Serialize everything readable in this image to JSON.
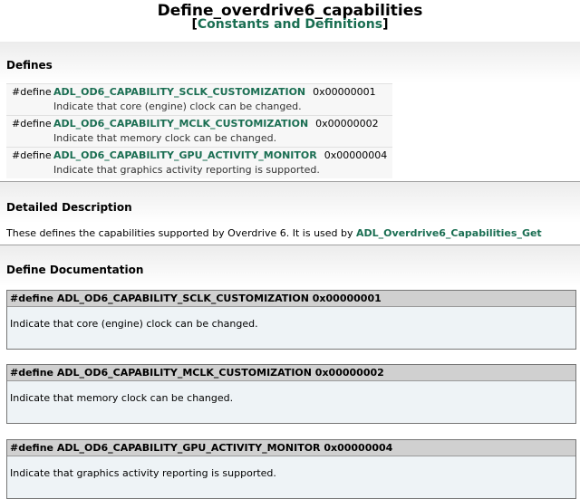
{
  "header": {
    "title": "Define_overdrive6_capabilities",
    "bracket_open": "[",
    "group_link": "Constants and Definitions",
    "bracket_close": "]"
  },
  "defines_section": {
    "heading": "Defines",
    "items": [
      {
        "keyword": "#define",
        "name": "ADL_OD6_CAPABILITY_SCLK_CUSTOMIZATION",
        "value": "0x00000001",
        "brief": "Indicate that core (engine) clock can be changed."
      },
      {
        "keyword": "#define",
        "name": "ADL_OD6_CAPABILITY_MCLK_CUSTOMIZATION",
        "value": "0x00000002",
        "brief": "Indicate that memory clock can be changed."
      },
      {
        "keyword": "#define",
        "name": "ADL_OD6_CAPABILITY_GPU_ACTIVITY_MONITOR",
        "value": "0x00000004",
        "brief": "Indicate that graphics activity reporting is supported."
      }
    ]
  },
  "detailed": {
    "heading": "Detailed Description",
    "text": "These defines the capabilities supported by Overdrive 6. It is used by ",
    "link": "ADL_Overdrive6_Capabilities_Get"
  },
  "define_docs": {
    "heading": "Define Documentation",
    "items": [
      {
        "proto": "#define ADL_OD6_CAPABILITY_SCLK_CUSTOMIZATION   0x00000001",
        "doc": "Indicate that core (engine) clock can be changed."
      },
      {
        "proto": "#define ADL_OD6_CAPABILITY_MCLK_CUSTOMIZATION   0x00000002",
        "doc": "Indicate that memory clock can be changed."
      },
      {
        "proto": "#define ADL_OD6_CAPABILITY_GPU_ACTIVITY_MONITOR   0x00000004",
        "doc": "Indicate that graphics activity reporting is supported."
      }
    ]
  },
  "colors": {
    "link": "#1a6e52",
    "proto_background": "#d0d0d0",
    "doc_background": "#eef3f6"
  }
}
